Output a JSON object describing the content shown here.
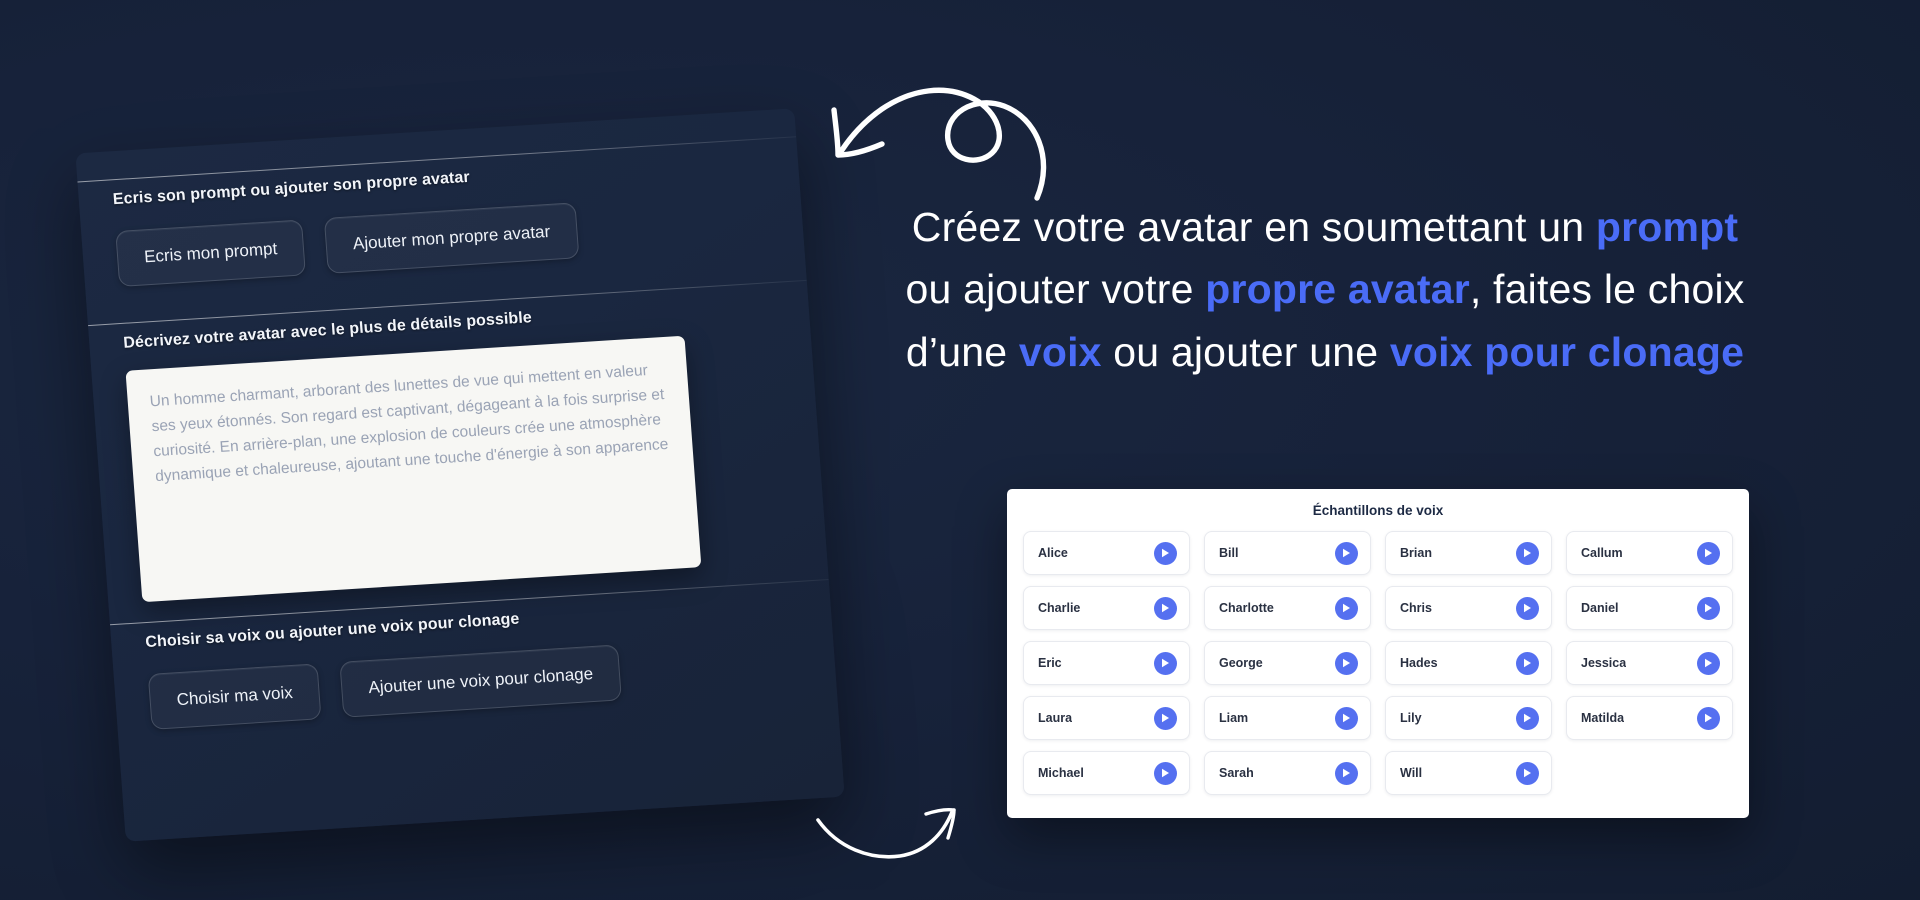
{
  "colors": {
    "background": "#17223a",
    "accent": "#4a6cf7",
    "play_button": "#5570f0",
    "panel_bg": "#ffffff",
    "textarea_bg": "#f7f7f4"
  },
  "app_card": {
    "section_prompt": {
      "label": "Ecris son prompt ou ajouter son propre avatar",
      "buttons": [
        {
          "label": "Ecris mon prompt"
        },
        {
          "label": "Ajouter mon propre avatar"
        }
      ]
    },
    "section_describe": {
      "label": "Décrivez votre avatar avec le plus de détails possible",
      "textarea_value": "Un homme charmant, arborant des lunettes de vue qui mettent en valeur ses yeux étonnés. Son regard est captivant, dégageant à la fois surprise et curiosité. En arrière-plan, une explosion de couleurs crée une atmosphère dynamique et chaleureuse, ajoutant une touche d'énergie à son apparence"
    },
    "section_voice": {
      "label": "Choisir sa voix ou ajouter une voix pour clonage",
      "buttons": [
        {
          "label": "Choisir ma voix"
        },
        {
          "label": "Ajouter une voix pour clonage"
        }
      ]
    }
  },
  "headline": {
    "line1_a": "Créez votre avatar en soumettant un ",
    "line1_accent": "prompt",
    "line2_a": "ou ajouter votre ",
    "line2_accent": "propre avatar",
    "line2_b": ", faites le choix",
    "line3_a": "d’une ",
    "line3_accent1": "voix",
    "line3_b": " ou ajouter une ",
    "line3_accent2": "voix pour clonage"
  },
  "voice_panel": {
    "title": "Échantillons de voix",
    "voices": [
      {
        "name": "Alice"
      },
      {
        "name": "Bill"
      },
      {
        "name": "Brian"
      },
      {
        "name": "Callum"
      },
      {
        "name": "Charlie"
      },
      {
        "name": "Charlotte"
      },
      {
        "name": "Chris"
      },
      {
        "name": "Daniel"
      },
      {
        "name": "Eric"
      },
      {
        "name": "George"
      },
      {
        "name": "Hades"
      },
      {
        "name": "Jessica"
      },
      {
        "name": "Laura"
      },
      {
        "name": "Liam"
      },
      {
        "name": "Lily"
      },
      {
        "name": "Matilda"
      },
      {
        "name": "Michael"
      },
      {
        "name": "Sarah"
      },
      {
        "name": "Will"
      }
    ]
  },
  "icons": {
    "play": "play-icon",
    "arrow_top": "curved-arrow-loop-icon",
    "arrow_bottom": "curved-arrow-up-right-icon"
  }
}
